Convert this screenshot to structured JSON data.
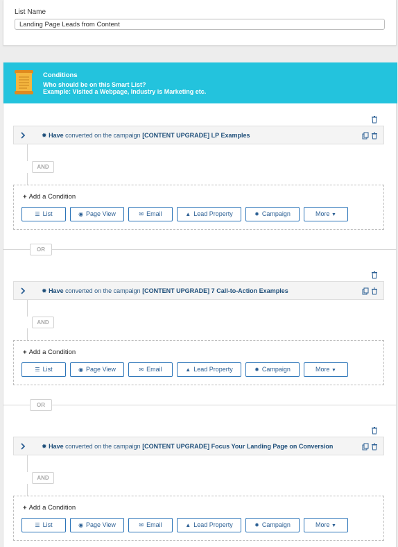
{
  "list_name": {
    "label": "List Name",
    "value": "Landing Page Leads from Content"
  },
  "conditions": {
    "title": "Conditions",
    "question": "Who should be on this Smart List?",
    "example": "Example: Visited a Webpage, Industry is Marketing etc.",
    "header_color": "#23c3dd"
  },
  "groups": [
    {
      "rule": {
        "have": "Have",
        "verb": "converted on the campaign",
        "campaign": "[CONTENT UPGRADE] LP Examples"
      },
      "and_label": "AND",
      "add_condition": "Add a Condition",
      "or_label": "OR"
    },
    {
      "rule": {
        "have": "Have",
        "verb": "converted on the campaign",
        "campaign": "[CONTENT UPGRADE] 7 Call-to-Action Examples"
      },
      "and_label": "AND",
      "add_condition": "Add a Condition",
      "or_label": "OR"
    },
    {
      "rule": {
        "have": "Have",
        "verb": "converted on the campaign",
        "campaign": "[CONTENT UPGRADE] Focus Your Landing Page on Conversion"
      },
      "and_label": "AND",
      "add_condition": "Add a Condition"
    }
  ],
  "buttons": {
    "list": "List",
    "page_view": "Page View",
    "email": "Email",
    "lead_property": "Lead Property",
    "campaign": "Campaign",
    "more": "More"
  },
  "icons": {
    "list": "list-icon",
    "page_view": "eye-icon",
    "email": "envelope-icon",
    "lead_property": "user-icon",
    "campaign": "campaign-icon",
    "more": "caret-down-icon"
  }
}
